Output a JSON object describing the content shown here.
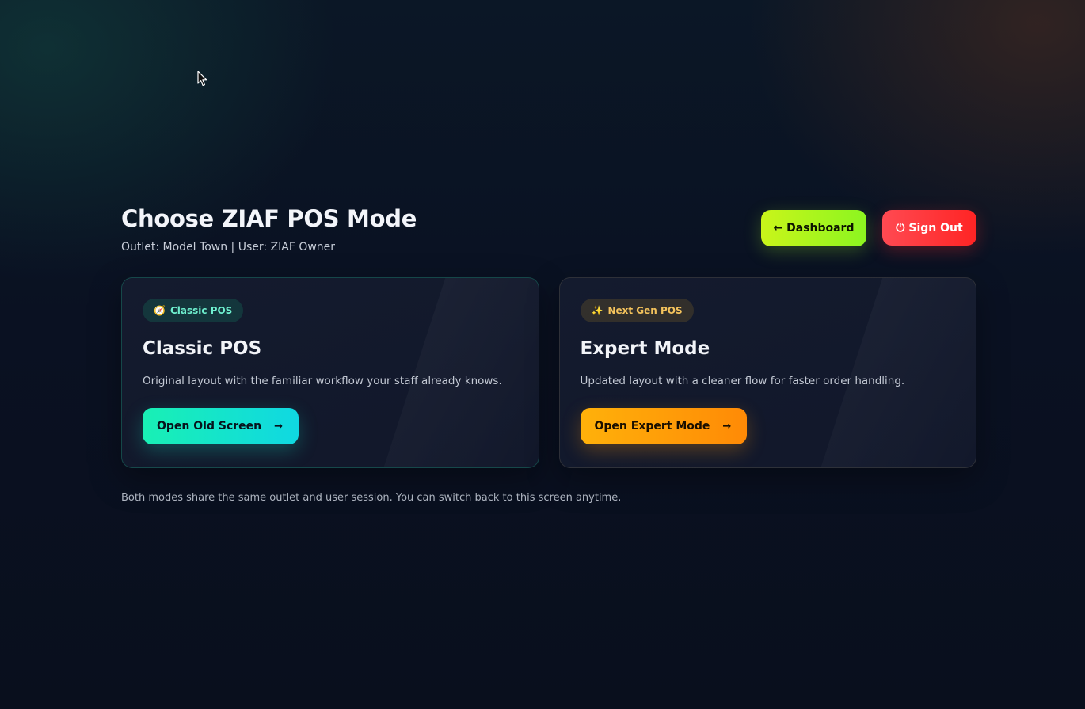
{
  "header": {
    "title": "Choose ZIAF POS Mode",
    "subtitle": "Outlet: Model Town | User: ZIAF Owner",
    "dashboard_label": "← Dashboard",
    "signout_icon": "⏻",
    "signout_label": "Sign Out"
  },
  "cards": [
    {
      "badge_icon": "🧭",
      "badge_label": "Classic POS",
      "title": "Classic POS",
      "description": "Original layout with the familiar workflow your staff already knows.",
      "button_label": "Open Old Screen",
      "button_arrow": "→"
    },
    {
      "badge_icon": "✨",
      "badge_label": "Next Gen POS",
      "title": "Expert Mode",
      "description": "Updated layout with a cleaner flow for faster order handling.",
      "button_label": "Open Expert Mode",
      "button_arrow": "→"
    }
  ],
  "footer_note": "Both modes share the same outlet and user session. You can switch back to this screen anytime.",
  "colors": {
    "dashboard_button": "#a8f51d",
    "signout_button": "#ff3434",
    "classic_button": "#14e4cb",
    "expert_button": "#ff9d08",
    "background": "#0a1122"
  }
}
